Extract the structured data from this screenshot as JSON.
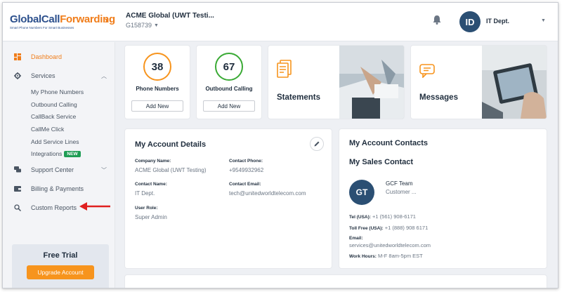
{
  "header": {
    "logo_part1": "GlobalCall",
    "logo_part2": "Forwarding",
    "logo_tagline": "Smart Phone Numbers For Smart Businesses",
    "account_name": "ACME Global (UWT Testi...",
    "account_id": "G158739",
    "user_initials": "ID",
    "user_name": "IT Dept."
  },
  "sidebar": {
    "dashboard": "Dashboard",
    "services": "Services",
    "services_items": [
      "My Phone Numbers",
      "Outbound Calling",
      "CallBack Service",
      "CallMe Click",
      "Add Service Lines",
      "Integrations"
    ],
    "new_badge": "NEW",
    "support_center": "Support Center",
    "billing": "Billing & Payments",
    "custom_reports": "Custom Reports",
    "trial_title": "Free Trial",
    "upgrade_label": "Upgrade Account"
  },
  "tiles": {
    "phone_numbers_count": "38",
    "phone_numbers_label": "Phone Numbers",
    "outbound_count": "67",
    "outbound_label": "Outbound Calling",
    "add_new": "Add New",
    "statements": "Statements",
    "messages": "Messages"
  },
  "account_details": {
    "title": "My Account Details",
    "company_name_label": "Company Name:",
    "company_name": "ACME Global (UWT Testing)",
    "contact_phone_label": "Contact Phone:",
    "contact_phone": "+9549932962",
    "contact_name_label": "Contact Name:",
    "contact_name": "IT Dept.",
    "contact_email_label": "Contact Email:",
    "contact_email": "tech@unitedworldtelecom.com",
    "user_role_label": "User Role:",
    "user_role": "Super Admin"
  },
  "contacts": {
    "title": "My Account Contacts",
    "subtitle": "My Sales Contact",
    "initials": "GT",
    "name": "GCF Team",
    "role": "Customer ...",
    "tel_label": "Tel (USA):",
    "tel": "+1 (561) 908-6171",
    "tollfree_label": "Toll Free (USA):",
    "tollfree": "+1 (888) 908 6171",
    "email_label": "Email:",
    "email": "services@unitedworldtelecom.com",
    "hours_label": "Work Hours:",
    "hours": "M-F 8am-5pm EST"
  },
  "colors": {
    "accent_orange": "#f07d1a",
    "ring_orange": "#f7941d",
    "ring_green": "#3aaa35",
    "navy": "#2b4f73",
    "badge_green": "#1f9d55",
    "arrow_red": "#e02020"
  }
}
